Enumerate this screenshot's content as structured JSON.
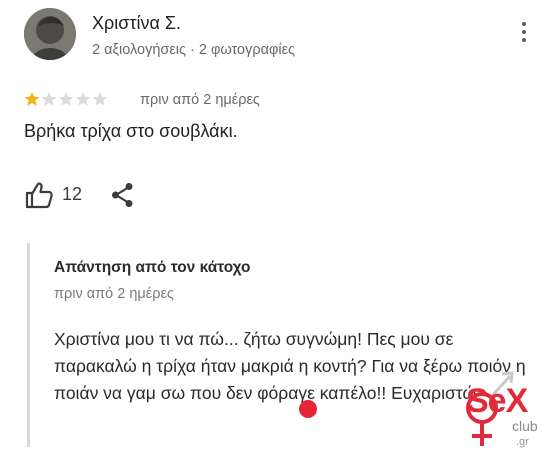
{
  "review": {
    "reviewer_name": "Χριστίνα Σ.",
    "reviewer_meta": "2 αξιολογήσεις · 2 φωτογραφίες",
    "rating": 1,
    "rating_max": 5,
    "time": "πριν από 2 ημέρες",
    "text": "Βρήκα τρίχα στο σουβλάκι.",
    "likes": "12"
  },
  "owner_reply": {
    "title": "Απάντηση από τον κάτοχο",
    "time": "πριν από 2 ημέρες",
    "text": "Χριστίνα μου τι να πώ... ζήτω συγνώμη! Πες μου σε παρακαλώ η τρίχα ήταν μακριά η κοντή? Για να ξέρω ποιόν η ποιάν να γαμ σω που δεν φόραγε καπέλο!! Ευχαριστώ"
  },
  "watermark": {
    "brand": "SeX",
    "sub": "club",
    "tld": ".gr"
  },
  "colors": {
    "star_filled": "#f6b416",
    "star_empty": "#dadce0",
    "accent_red": "#e8243b"
  },
  "icons": {
    "menu": "more-vert-icon",
    "like": "thumb-up-icon",
    "share": "share-icon"
  }
}
